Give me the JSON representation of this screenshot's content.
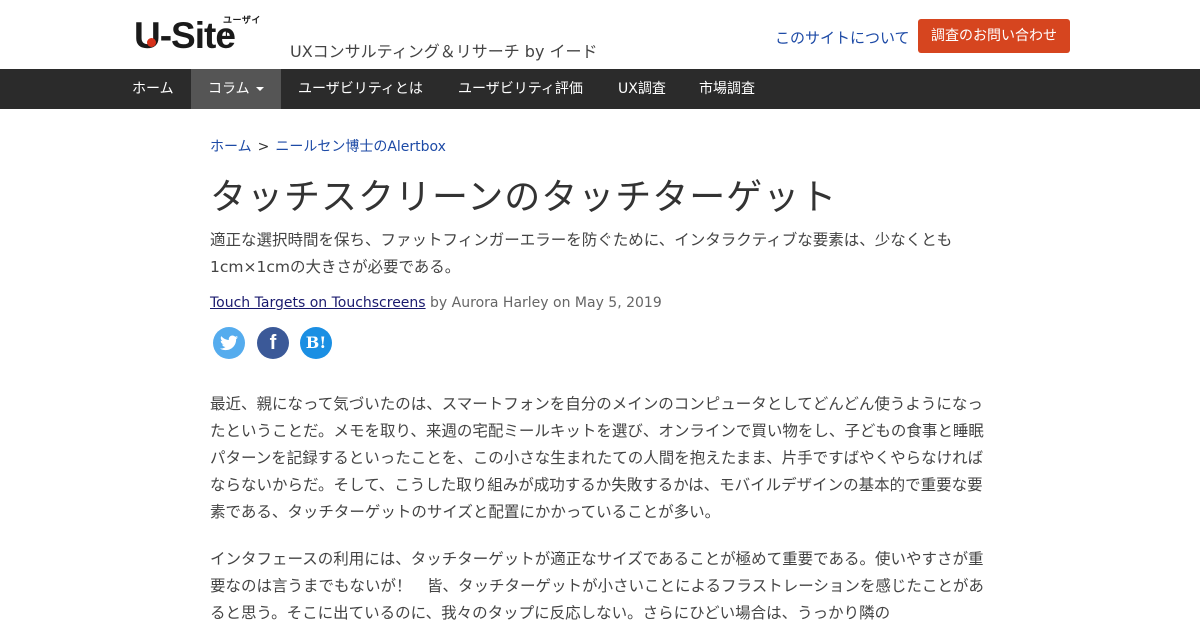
{
  "header": {
    "logo_text": "U-Site",
    "logo_sub": "ユーザイト",
    "tagline": "UXコンサルティング＆リサーチ by イード",
    "about_link": "このサイトについて",
    "contact_button": "調査のお問い合わせ",
    "colors": {
      "accent": "#d6451f",
      "link": "#1d4aa6",
      "nav_bg": "#2b2b2b"
    }
  },
  "nav": {
    "items": [
      {
        "label": "ホーム"
      },
      {
        "label": "コラム",
        "active": true,
        "dropdown": true
      },
      {
        "label": "ユーザビリティとは"
      },
      {
        "label": "ユーザビリティ評価"
      },
      {
        "label": "UX調査"
      },
      {
        "label": "市場調査"
      }
    ]
  },
  "breadcrumb": {
    "home": "ホーム",
    "separator": ">",
    "current": "ニールセン博士のAlertbox"
  },
  "article": {
    "title": "タッチスクリーンのタッチターゲット",
    "lead": "適正な選択時間を保ち、ファットフィンガーエラーを防ぐために、インタラクティブな要素は、少なくとも1cm×1cmの大きさが必要である。",
    "original_link": "Touch Targets on Touchscreens",
    "byline_rest": " by Aurora Harley on May 5, 2019",
    "share": {
      "twitter_icon": "twitter-icon",
      "facebook_glyph": "f",
      "hatena_glyph": "B!"
    },
    "paragraphs": [
      "最近、親になって気づいたのは、スマートフォンを自分のメインのコンピュータとしてどんどん使うようになったということだ。メモを取り、来週の宅配ミールキットを選び、オンラインで買い物をし、子どもの食事と睡眠パターンを記録するといったことを、この小さな生まれたての人間を抱えたまま、片手ですばやくやらなければならないからだ。そして、こうした取り組みが成功するか失敗するかは、モバイルデザインの基本的で重要な要素である、タッチターゲットのサイズと配置にかかっていることが多い。",
      "インタフェースの利用には、タッチターゲットが適正なサイズであることが極めて重要である。使いやすさが重要なのは言うまでもないが！　皆、タッチターゲットが小さいことによるフラストレーションを感じたことがあると思う。そこに出ているのに、我々のタップに反応しない。さらにひどい場合は、うっかり隣の"
    ]
  }
}
